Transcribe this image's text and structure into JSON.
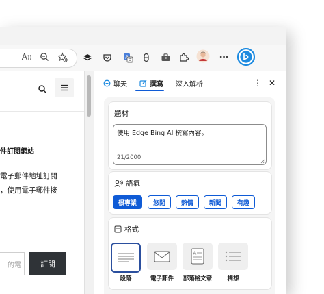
{
  "toolbar": {
    "read_aloud_label": "A",
    "icons": [
      "read-aloud-icon",
      "zoom-out-icon",
      "favorites-add-icon",
      "layers-icon",
      "pocket-icon",
      "translate-icon",
      "capsule-icon",
      "briefcase-icon",
      "extensions-icon",
      "profile-icon",
      "more-icon",
      "bing-icon"
    ],
    "more_label": "···"
  },
  "webpage": {
    "search_glyph": "⌕",
    "menu_glyph": "≡",
    "heading": "件訂閱網站",
    "line1": "電子郵件地址訂閱",
    "line2": "，使用電子郵件接",
    "email_placeholder": "的電",
    "subscribe_label": "訂閱"
  },
  "sidebar": {
    "tabs": [
      {
        "label": "聊天",
        "active": false
      },
      {
        "label": "撰寫",
        "active": true
      },
      {
        "label": "深入解析",
        "active": false
      }
    ],
    "more_label": "⋮",
    "close_label": "✕",
    "topic": {
      "title": "題材",
      "value": "使用 Edge Bing AI 撰寫內容。",
      "counter": "21/2000"
    },
    "tone": {
      "title": "語氣",
      "options": [
        "很專業",
        "悠閒",
        "熱情",
        "新聞",
        "有趣"
      ],
      "selected": "很專業"
    },
    "format": {
      "title": "格式",
      "options": [
        "段落",
        "電子郵件",
        "部落格文章",
        "構想"
      ],
      "selected": "段落"
    }
  },
  "colors": {
    "accent": "#0f5bd6",
    "selected_border": "#2b4f9e",
    "subscribe_bg": "#2f3337"
  }
}
